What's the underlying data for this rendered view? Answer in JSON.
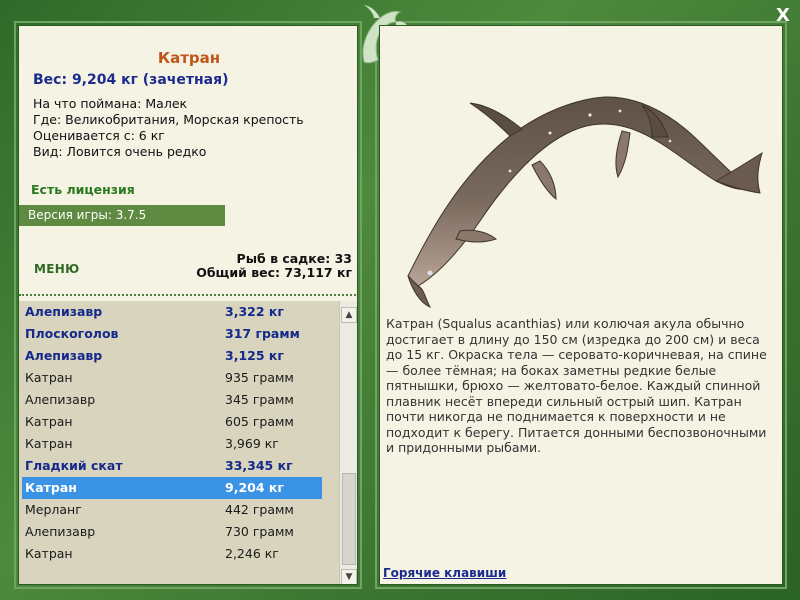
{
  "fish": {
    "name": "Катран",
    "weight_line": "Вес: 9,204 кг (зачетная)",
    "info": [
      {
        "label": "На что поймана:",
        "value": "Малек"
      },
      {
        "label": "Где:",
        "value": "Великобритания, Морская крепость"
      },
      {
        "label": "Оценивается с:",
        "value": "6 кг"
      },
      {
        "label": "Вид:",
        "value": "Ловится очень редко"
      }
    ],
    "license": "Есть лицензия",
    "version": "Версия игры: 3.7.5"
  },
  "menu_label": "МЕНЮ",
  "stats": {
    "count_line": "Рыб в садке: 33",
    "total_line": "Общий вес: 73,117 кг"
  },
  "catches": [
    {
      "name": "Алепизавр",
      "weight": "3,322 кг",
      "trophy": true
    },
    {
      "name": "Плоскоголов",
      "weight": "317 грамм",
      "trophy": true
    },
    {
      "name": "Алепизавр",
      "weight": "3,125 кг",
      "trophy": true
    },
    {
      "name": "Катран",
      "weight": "935 грамм",
      "trophy": false
    },
    {
      "name": "Алепизавр",
      "weight": "345 грамм",
      "trophy": false
    },
    {
      "name": "Катран",
      "weight": "605 грамм",
      "trophy": false
    },
    {
      "name": "Катран",
      "weight": "3,969 кг",
      "trophy": false
    },
    {
      "name": "Гладкий скат",
      "weight": "33,345 кг",
      "trophy": true
    },
    {
      "name": "Катран",
      "weight": "9,204 кг",
      "trophy": true,
      "selected": true
    },
    {
      "name": "Мерланг",
      "weight": "442 грамм",
      "trophy": false
    },
    {
      "name": "Алепизавр",
      "weight": "730 грамм",
      "trophy": false
    },
    {
      "name": "Катран",
      "weight": "2,246 кг",
      "trophy": false
    }
  ],
  "description": "Катран (Squalus acanthias) или колючая акула обычно достигает в длину до 150 см (изредка до 200 см) и веса до 15 кг. Окраска тела — серовато-коричневая, на спине — более тёмная; на боках заметны редкие белые пятнышки, брюхо — желтовато-белое. Каждый спинной плавник несёт впереди сильный острый шип. Катран почти никогда не поднимается к поверхности и не подходит к берегу. Питается донными беспозвоночными и придонными рыбами.",
  "hotkeys_label": "Горячие клавиши",
  "close_label": "X",
  "icons": {
    "logo": "dolphin-logo-icon",
    "scroll_up": "arrow-up-icon",
    "scroll_down": "arrow-down-icon"
  },
  "colors": {
    "frame": "#3f7a34",
    "panel": "#f5f3e3",
    "title": "#c0561a",
    "trophy": "#162a8c",
    "selected": "#3b93e5",
    "license": "#2a7a1f"
  }
}
